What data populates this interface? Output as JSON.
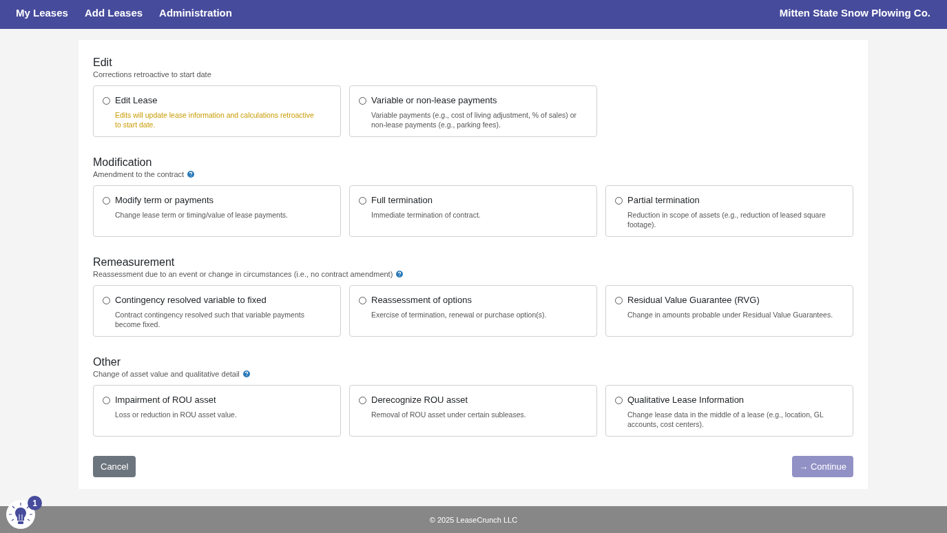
{
  "nav": {
    "links": [
      "My Leases",
      "Add Leases",
      "Administration"
    ],
    "company": "Mitten State Snow Plowing Co."
  },
  "sections": [
    {
      "title": "Edit",
      "subtitle": "Corrections retroactive to start date",
      "help": false,
      "options": [
        {
          "label": "Edit Lease",
          "description": "Edits will update lease information and calculations retroactive to start date.",
          "kind": "warning",
          "selected": false
        },
        {
          "label": "Variable or non-lease payments",
          "description": "Variable payments (e.g., cost of living adjustment, % of sales) or non-lease payments (e.g., parking fees).",
          "kind": "normal",
          "selected": false
        }
      ]
    },
    {
      "title": "Modification",
      "subtitle": "Amendment to the contract",
      "help": true,
      "options": [
        {
          "label": "Modify term or payments",
          "description": "Change lease term or timing/value of lease payments.",
          "kind": "normal",
          "selected": false
        },
        {
          "label": "Full termination",
          "description": "Immediate termination of contract.",
          "kind": "normal",
          "selected": false
        },
        {
          "label": "Partial termination",
          "description": "Reduction in scope of assets (e.g., reduction of leased square footage).",
          "kind": "normal",
          "selected": false
        }
      ]
    },
    {
      "title": "Remeasurement",
      "subtitle": "Reassessment due to an event or change in circumstances (i.e., no contract amendment)",
      "help": true,
      "options": [
        {
          "label": "Contingency resolved variable to fixed",
          "description": "Contract contingency resolved such that variable payments become fixed.",
          "kind": "normal",
          "selected": false
        },
        {
          "label": "Reassessment of options",
          "description": "Exercise of termination, renewal or purchase option(s).",
          "kind": "normal",
          "selected": false
        },
        {
          "label": "Residual Value Guarantee (RVG)",
          "description": "Change in amounts probable under Residual Value Guarantees.",
          "kind": "normal",
          "selected": false
        }
      ]
    },
    {
      "title": "Other",
      "subtitle": "Change of asset value and qualitative detail",
      "help": true,
      "options": [
        {
          "label": "Impairment of ROU asset",
          "description": "Loss or reduction in ROU asset value.",
          "kind": "normal",
          "selected": false
        },
        {
          "label": "Derecognize ROU asset",
          "description": "Removal of ROU asset under certain subleases.",
          "kind": "normal",
          "selected": false
        },
        {
          "label": "Qualitative Lease Information",
          "description": "Change lease data in the middle of a lease (e.g., location, GL accounts, cost centers).",
          "kind": "normal",
          "selected": false
        }
      ]
    }
  ],
  "buttons": {
    "cancel": "Cancel",
    "continue": {
      "arrow": "→",
      "label": "Continue",
      "disabled": true
    }
  },
  "footer": "©  2025 LeaseCrunch LLC",
  "tips": {
    "badge": "1"
  }
}
